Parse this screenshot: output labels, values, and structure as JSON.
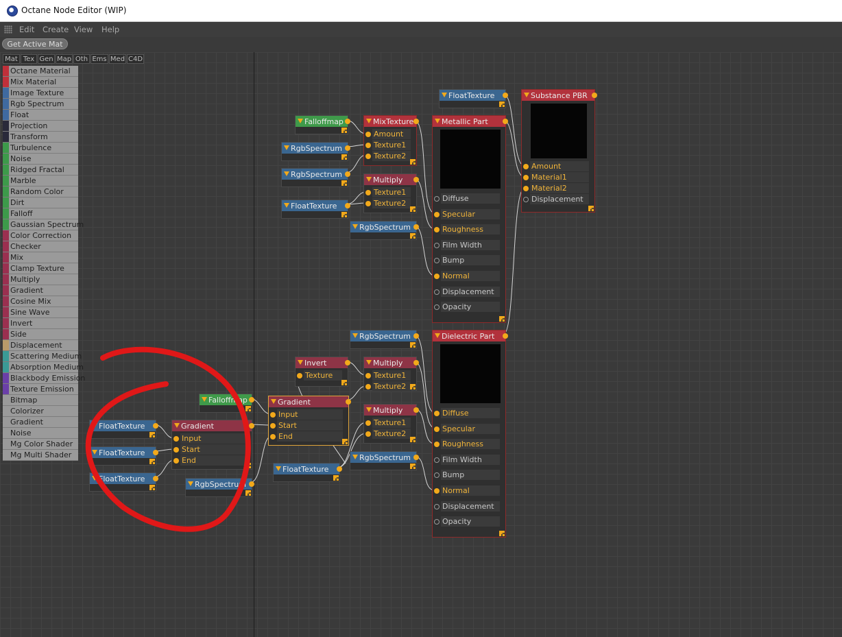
{
  "window": {
    "title": "Octane Node Editor (WIP)"
  },
  "menu": [
    "Edit",
    "Create",
    "View",
    "Help"
  ],
  "toolbar": {
    "get_active_mat": "Get Active Mat"
  },
  "tabs": [
    "Mat",
    "Tex",
    "Gen",
    "Map",
    "Oth",
    "Ems",
    "Med",
    "C4D"
  ],
  "palette": [
    {
      "label": "Octane Material",
      "color": "#c0303a"
    },
    {
      "label": "Mix Material",
      "color": "#c0303a"
    },
    {
      "label": "Image Texture",
      "color": "#3f6aa0"
    },
    {
      "label": "Rgb Spectrum",
      "color": "#3f6aa0"
    },
    {
      "label": "Float",
      "color": "#3f6aa0"
    },
    {
      "label": "Projection",
      "color": "#2a2a3a"
    },
    {
      "label": "Transform",
      "color": "#2a2a3a"
    },
    {
      "label": "Turbulence",
      "color": "#3d9a4a"
    },
    {
      "label": "Noise",
      "color": "#3d9a4a"
    },
    {
      "label": "Ridged Fractal",
      "color": "#3d9a4a"
    },
    {
      "label": "Marble",
      "color": "#3d9a4a"
    },
    {
      "label": "Random Color",
      "color": "#3d9a4a"
    },
    {
      "label": "Dirt",
      "color": "#3d9a4a"
    },
    {
      "label": "Falloff",
      "color": "#3d9a4a"
    },
    {
      "label": "Gaussian Spectrum",
      "color": "#3d9a4a"
    },
    {
      "label": "Color Correction",
      "color": "#9a3050"
    },
    {
      "label": "Checker",
      "color": "#9a3050"
    },
    {
      "label": "Mix",
      "color": "#9a3050"
    },
    {
      "label": "Clamp Texture",
      "color": "#9a3050"
    },
    {
      "label": "Multiply",
      "color": "#9a3050"
    },
    {
      "label": "Gradient",
      "color": "#9a3050"
    },
    {
      "label": "Cosine Mix",
      "color": "#9a3050"
    },
    {
      "label": "Sine Wave",
      "color": "#9a3050"
    },
    {
      "label": "Invert",
      "color": "#9a3050"
    },
    {
      "label": "Side",
      "color": "#9a3050"
    },
    {
      "label": "Displacement",
      "color": "#b89a6a"
    },
    {
      "label": "Scattering Medium",
      "color": "#3a9a96"
    },
    {
      "label": "Absorption Medium",
      "color": "#3a9a96"
    },
    {
      "label": "Blackbody Emission",
      "color": "#6a3fa8"
    },
    {
      "label": "Texture Emission",
      "color": "#6a3fa8"
    },
    {
      "label": "Bitmap",
      "color": "#9a9a9a"
    },
    {
      "label": "Colorizer",
      "color": "#9a9a9a"
    },
    {
      "label": "Gradient",
      "color": "#9a9a9a"
    },
    {
      "label": "Noise",
      "color": "#9a9a9a"
    },
    {
      "label": "Mg Color Shader",
      "color": "#9a9a9a"
    },
    {
      "label": "Mg Multi Shader",
      "color": "#9a9a9a"
    }
  ],
  "colors": {
    "red_header": "#b2323c",
    "blue_header": "#3a6690",
    "green_header": "#3f9a4a",
    "mauve_header": "#8e3446",
    "port_on": "#f2a91b",
    "annotation": "#e01818",
    "wire": "#d6d6d6"
  },
  "nodes": [
    {
      "id": "falloff1",
      "title": "Falloffmap",
      "kind": "green",
      "ports": []
    },
    {
      "id": "mixtex",
      "title": "MixTexture",
      "kind": "red",
      "ports": [
        {
          "label": "Amount",
          "on": true
        },
        {
          "label": "Texture1",
          "on": true
        },
        {
          "label": "Texture2",
          "on": true
        }
      ]
    },
    {
      "id": "rgb1",
      "title": "RgbSpectrum",
      "kind": "blue",
      "ports": []
    },
    {
      "id": "rgb2",
      "title": "RgbSpectrum",
      "kind": "blue",
      "ports": []
    },
    {
      "id": "mul1",
      "title": "Multiply",
      "kind": "mauve",
      "ports": [
        {
          "label": "Texture1",
          "on": true
        },
        {
          "label": "Texture2",
          "on": true
        }
      ]
    },
    {
      "id": "float1",
      "title": "FloatTexture",
      "kind": "blue",
      "ports": []
    },
    {
      "id": "rgb3",
      "title": "RgbSpectrum",
      "kind": "blue",
      "ports": []
    },
    {
      "id": "float_top",
      "title": "FloatTexture",
      "kind": "blue",
      "ports": []
    },
    {
      "id": "metallic",
      "title": "Metallic Part",
      "kind": "red",
      "ports": [
        {
          "label": "Diffuse",
          "on": false
        },
        {
          "label": "Specular",
          "on": true
        },
        {
          "label": "Roughness",
          "on": true
        },
        {
          "label": "Film Width",
          "on": false
        },
        {
          "label": "Bump",
          "on": false
        },
        {
          "label": "Normal",
          "on": true
        },
        {
          "label": "Displacement",
          "on": false
        },
        {
          "label": "Opacity",
          "on": false
        }
      ]
    },
    {
      "id": "substance",
      "title": "Substance PBR",
      "kind": "red",
      "ports": [
        {
          "label": "Amount",
          "on": true
        },
        {
          "label": "Material1",
          "on": true
        },
        {
          "label": "Material2",
          "on": true
        },
        {
          "label": "Displacement",
          "on": false
        }
      ]
    },
    {
      "id": "rgb4",
      "title": "RgbSpectrum",
      "kind": "blue",
      "ports": []
    },
    {
      "id": "dielectric",
      "title": "Dielectric Part",
      "kind": "red",
      "ports": [
        {
          "label": "Diffuse",
          "on": true
        },
        {
          "label": "Specular",
          "on": true
        },
        {
          "label": "Roughness",
          "on": true
        },
        {
          "label": "Film Width",
          "on": false
        },
        {
          "label": "Bump",
          "on": false
        },
        {
          "label": "Normal",
          "on": true
        },
        {
          "label": "Displacement",
          "on": false
        },
        {
          "label": "Opacity",
          "on": false
        }
      ]
    },
    {
      "id": "invert",
      "title": "Invert",
      "kind": "mauve",
      "ports": [
        {
          "label": "Texture",
          "on": true
        }
      ]
    },
    {
      "id": "mul2",
      "title": "Multiply",
      "kind": "mauve",
      "ports": [
        {
          "label": "Texture1",
          "on": true
        },
        {
          "label": "Texture2",
          "on": true
        }
      ]
    },
    {
      "id": "mul3",
      "title": "Multiply",
      "kind": "mauve",
      "ports": [
        {
          "label": "Texture1",
          "on": true
        },
        {
          "label": "Texture2",
          "on": true
        }
      ]
    },
    {
      "id": "rgb5",
      "title": "RgbSpectrum",
      "kind": "blue",
      "ports": []
    },
    {
      "id": "gradient2",
      "title": "Gradient",
      "kind": "mauve",
      "ports": [
        {
          "label": "Input",
          "on": true
        },
        {
          "label": "Start",
          "on": true
        },
        {
          "label": "End",
          "on": true
        }
      ]
    },
    {
      "id": "falloff2",
      "title": "Falloffmap",
      "kind": "green",
      "ports": []
    },
    {
      "id": "float2",
      "title": "FloatTexture",
      "kind": "blue",
      "ports": []
    },
    {
      "id": "float3",
      "title": "FloatTexture",
      "kind": "blue",
      "ports": []
    },
    {
      "id": "float4",
      "title": "FloatTexture",
      "kind": "blue",
      "ports": []
    },
    {
      "id": "float5",
      "title": "FloatTexture",
      "kind": "blue",
      "ports": []
    },
    {
      "id": "gradient1",
      "title": "Gradient",
      "kind": "mauve",
      "ports": [
        {
          "label": "Input",
          "on": true
        },
        {
          "label": "Start",
          "on": true
        },
        {
          "label": "End",
          "on": true
        }
      ]
    },
    {
      "id": "rgb6",
      "title": "RgbSpectrum",
      "kind": "blue",
      "ports": []
    }
  ]
}
